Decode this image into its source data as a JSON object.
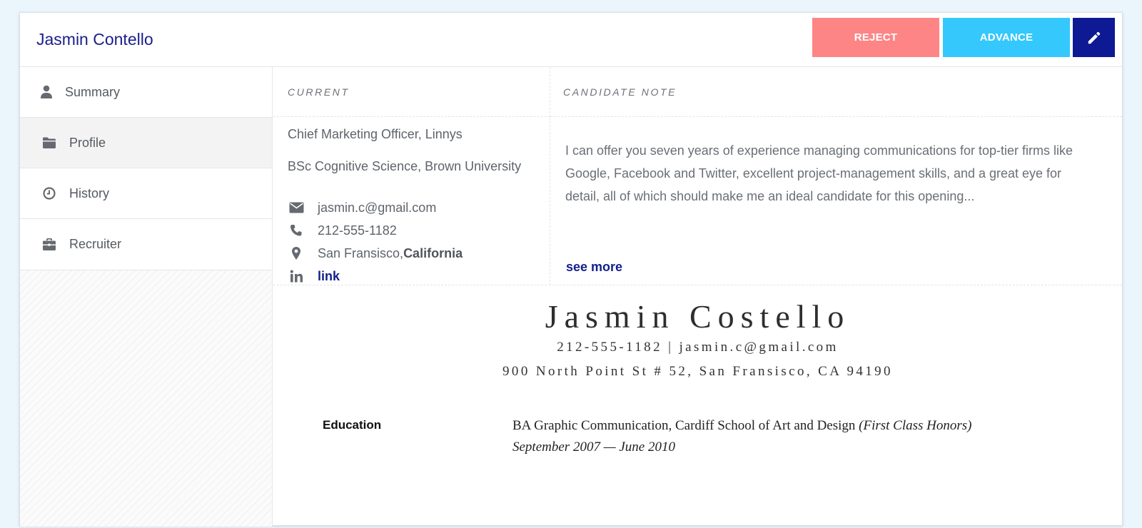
{
  "header": {
    "candidate_name": "Jasmin Contello",
    "reject_label": "REJECT",
    "advance_label": "ADVANCE"
  },
  "sidebar": {
    "items": [
      {
        "label": "Summary",
        "icon": "user-icon"
      },
      {
        "label": "Profile",
        "icon": "folder-icon"
      },
      {
        "label": "History",
        "icon": "clock-icon"
      },
      {
        "label": "Recruiter",
        "icon": "briefcase-icon"
      }
    ],
    "active": "Profile"
  },
  "current": {
    "heading": "CURRENT",
    "position": "Chief Marketing Officer, Linnys",
    "education": "BSc Cognitive Science, Brown University",
    "email": "jasmin.c@gmail.com",
    "phone": "212-555-1182",
    "city": "San Fransisco, ",
    "state": "California",
    "linkedin_label": "link"
  },
  "note": {
    "heading": "CANDIDATE NOTE",
    "text": "I can offer you seven years of experience managing communications for top-tier firms like Google, Facebook and Twitter, excellent project-management skills, and a great eye for detail, all of which should make me an ideal candidate for this opening...",
    "see_more": "see more"
  },
  "resume": {
    "name": "Jasmin Costello",
    "contact": "212-555-1182 | jasmin.c@gmail.com",
    "address": "900 North Point St # 52, San Fransisco, CA 94190",
    "education_label": "Education",
    "degree": "BA Graphic Communication, Cardiff School of Art and Design ",
    "honors": "(First Class Honors)",
    "dates": "September 2007 — June 2010"
  },
  "colors": {
    "reject": "#fe8585",
    "advance": "#34c8fc",
    "edit": "#0e1a94",
    "accent_text": "#1a1f8c",
    "background": "#eaf5fc"
  }
}
